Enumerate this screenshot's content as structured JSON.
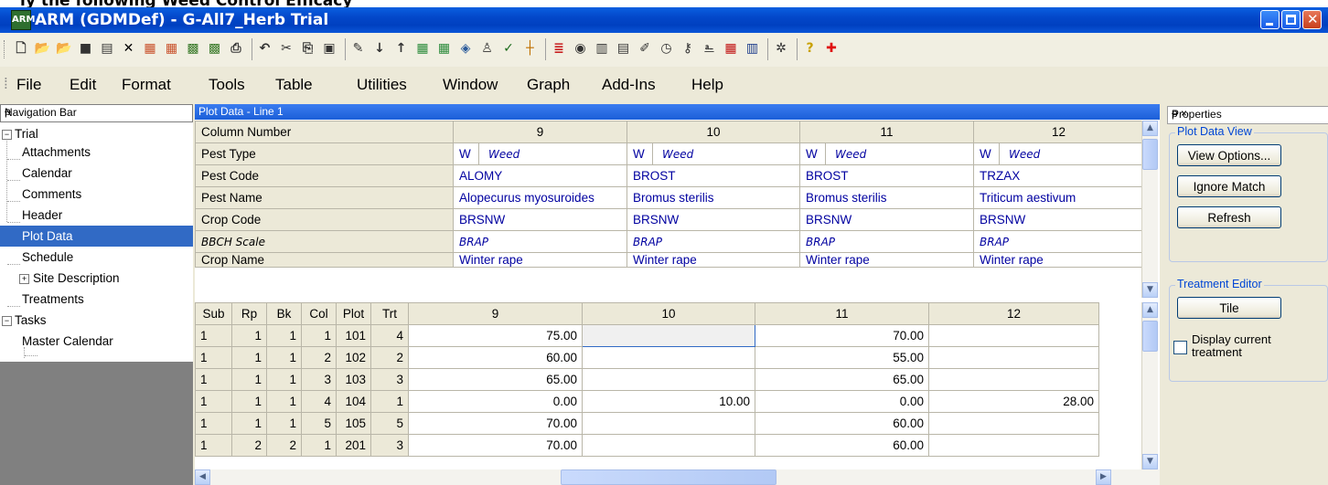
{
  "window": {
    "strip_text": "ly the following Weed Control Efficacy",
    "title": "ARM (GDMDef) - G-All7_Herb Trial",
    "app_icon": "ARM"
  },
  "toolbar_icons": [
    "new-icon",
    "open-icon",
    "open-folder-icon",
    "save-icon",
    "save-as-icon",
    "delete-icon",
    "plot-icon",
    "plot-icon",
    "chart-icon",
    "chart-icon",
    "print-icon",
    "undo-icon",
    "cut-icon",
    "copy-icon",
    "paste-icon",
    "spell-icon",
    "sort-asc-icon",
    "sort-desc-icon",
    "arm-icon",
    "arm-icon",
    "globe-icon",
    "person-icon",
    "check-icon",
    "plus-icon",
    "list-icon",
    "disk-icon",
    "book-icon",
    "calc-icon",
    "edit-icon",
    "clock-icon",
    "key-icon",
    "clip-icon",
    "grid-icon",
    "table-icon",
    "settings-icon",
    "help-icon",
    "red-cross-icon"
  ],
  "menu": [
    "File",
    "Edit",
    "Format",
    "Tools",
    "Table",
    "Utilities",
    "Window",
    "Graph",
    "Add-Ins",
    "Help"
  ],
  "nav": {
    "title": "Navigation Bar",
    "pin": "ᵽ",
    "items": [
      {
        "label": "Trial",
        "expander": "−"
      },
      {
        "label": "Attachments"
      },
      {
        "label": "Calendar"
      },
      {
        "label": "Comments"
      },
      {
        "label": "Header"
      },
      {
        "label": "Plot Data",
        "selected": true
      },
      {
        "label": "Schedule"
      },
      {
        "label": "Site Description",
        "expander": "+"
      },
      {
        "label": "Treatments"
      },
      {
        "label": "Tasks",
        "expander": "−"
      },
      {
        "label": "Master Calendar"
      }
    ]
  },
  "plot": {
    "title": "Plot Data - Line 1",
    "upper": {
      "column_number_label": "Column Number",
      "columns": [
        "9",
        "10",
        "11",
        "12"
      ],
      "rows": [
        {
          "label": "Pest Type",
          "values": [
            [
              "W",
              "Weed"
            ],
            [
              "W",
              "Weed"
            ],
            [
              "W",
              "Weed"
            ],
            [
              "W",
              "Weed"
            ]
          ]
        },
        {
          "label": "Pest Code",
          "values": [
            "ALOMY",
            "BROST",
            "BROST",
            "TRZAX"
          ]
        },
        {
          "label": "Pest Name",
          "values": [
            "Alopecurus myosuroides",
            "Bromus sterilis",
            "Bromus sterilis",
            "Triticum aestivum"
          ]
        },
        {
          "label": "Crop Code",
          "values": [
            "BRSNW",
            "BRSNW",
            "BRSNW",
            "BRSNW"
          ]
        },
        {
          "label": "BBCH Scale",
          "values": [
            "BRAP",
            "BRAP",
            "BRAP",
            "BRAP"
          ]
        },
        {
          "label": "Crop Name",
          "values": [
            "Winter rape",
            "Winter rape",
            "Winter rape",
            "Winter rape"
          ]
        }
      ]
    },
    "lower": {
      "headers": [
        "Sub",
        "Rp",
        "Bk",
        "Col",
        "Plot",
        "Trt",
        "9",
        "10",
        "11",
        "12"
      ],
      "rows": [
        [
          "1",
          "1",
          "1",
          "1",
          "101",
          "4",
          "75.00",
          "",
          "70.00",
          ""
        ],
        [
          "1",
          "1",
          "1",
          "2",
          "102",
          "2",
          "60.00",
          "",
          "55.00",
          ""
        ],
        [
          "1",
          "1",
          "1",
          "3",
          "103",
          "3",
          "65.00",
          "",
          "65.00",
          ""
        ],
        [
          "1",
          "1",
          "1",
          "4",
          "104",
          "1",
          "0.00",
          "10.00",
          "0.00",
          "28.00"
        ],
        [
          "1",
          "1",
          "1",
          "5",
          "105",
          "5",
          "70.00",
          "",
          "60.00",
          ""
        ],
        [
          "1",
          "2",
          "2",
          "1",
          "201",
          "3",
          "70.00",
          "",
          "60.00",
          ""
        ]
      ]
    }
  },
  "properties": {
    "title": "Properties",
    "controls": "ᵽ ×",
    "plot_data_view": "Plot Data View",
    "view_options": "View Options...",
    "ignore_match": "Ignore Match",
    "refresh": "Refresh",
    "treatment_editor": "Treatment Editor",
    "tile": "Tile",
    "display_current": "Display current treatment",
    "display_current_checked": false
  }
}
